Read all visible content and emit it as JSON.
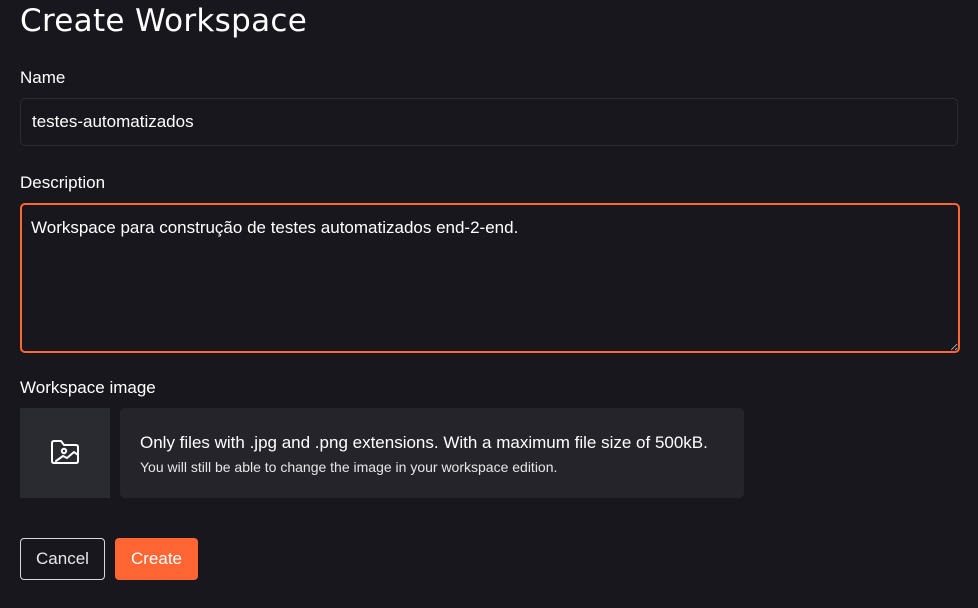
{
  "page": {
    "title": "Create Workspace"
  },
  "form": {
    "name": {
      "label": "Name",
      "value": "testes-automatizados"
    },
    "description": {
      "label": "Description",
      "value": "Workspace para construção de testes automatizados end-2-end."
    },
    "image": {
      "label": "Workspace image",
      "icon": "image-upload-icon",
      "info_main": "Only files with .jpg and .png extensions. With a maximum file size of 500kB.",
      "info_sub": "You will still be able to change the image in your workspace edition."
    }
  },
  "actions": {
    "cancel_label": "Cancel",
    "create_label": "Create"
  },
  "colors": {
    "background": "#18171d",
    "accent": "#ff6633",
    "panel": "#25242b",
    "upload_box": "#2a2a31"
  }
}
